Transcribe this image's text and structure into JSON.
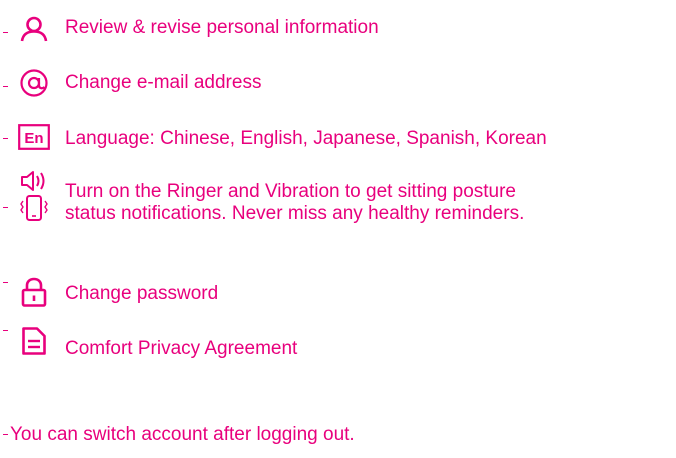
{
  "accent_color": "#e8007d",
  "menu": {
    "items": [
      {
        "icon": "person-icon",
        "label": "Review & revise personal information"
      },
      {
        "icon": "at-sign-icon",
        "label": "Change e-mail address"
      },
      {
        "icon": "language-icon",
        "icon_text": "En",
        "label": "Language: Chinese, English, Japanese, Spanish, Korean"
      },
      {
        "icon": "ringer-vibration-icon",
        "label_line1": "Turn on the Ringer and Vibration to get sitting posture",
        "label_line2": "status notifications. Never miss any healthy reminders."
      },
      {
        "icon": "lock-icon",
        "label": "Change password"
      },
      {
        "icon": "document-icon",
        "label": "Comfort Privacy Agreement"
      }
    ]
  },
  "footer": {
    "text": "You can switch account after logging out."
  }
}
